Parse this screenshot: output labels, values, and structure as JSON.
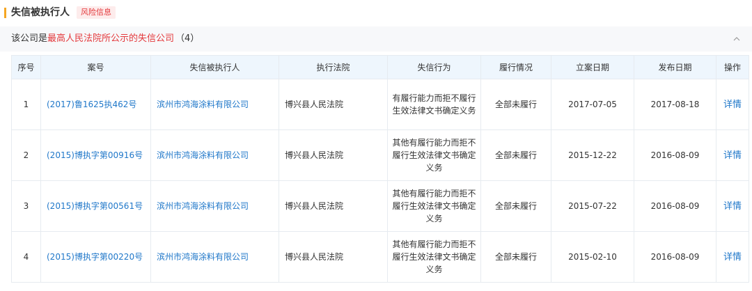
{
  "header": {
    "title": "失信被执行人",
    "tag": "风险信息"
  },
  "summary": {
    "prefix": "该公司是",
    "highlight": "最高人民法院所公示的失信公司",
    "count": "（4）"
  },
  "table": {
    "columns": [
      "序号",
      "案号",
      "失信被执行人",
      "执行法院",
      "失信行为",
      "履行情况",
      "立案日期",
      "发布日期",
      "操作"
    ],
    "rows": [
      {
        "index": "1",
        "case_no": "(2017)鲁1625执462号",
        "executee": "滨州市鸿海涂料有限公司",
        "court": "博兴县人民法院",
        "behavior": "有履行能力而拒不履行生效法律文书确定义务",
        "status": "全部未履行",
        "filing_date": "2017-07-05",
        "publish_date": "2017-08-18",
        "action": "详情"
      },
      {
        "index": "2",
        "case_no": "(2015)博执字第00916号",
        "executee": "滨州市鸿海涂料有限公司",
        "court": "博兴县人民法院",
        "behavior": "其他有履行能力而拒不履行生效法律文书确定义务",
        "status": "全部未履行",
        "filing_date": "2015-12-22",
        "publish_date": "2016-08-09",
        "action": "详情"
      },
      {
        "index": "3",
        "case_no": "(2015)博执字第00561号",
        "executee": "滨州市鸿海涂料有限公司",
        "court": "博兴县人民法院",
        "behavior": "其他有履行能力而拒不履行生效法律文书确定义务",
        "status": "全部未履行",
        "filing_date": "2015-07-22",
        "publish_date": "2016-08-09",
        "action": "详情"
      },
      {
        "index": "4",
        "case_no": "(2015)博执字第00220号",
        "executee": "滨州市鸿海涂料有限公司",
        "court": "博兴县人民法院",
        "behavior": "其他有履行能力而拒不履行生效法律文书确定义务",
        "status": "全部未履行",
        "filing_date": "2015-02-10",
        "publish_date": "2016-08-09",
        "action": "详情"
      }
    ]
  },
  "icons": {
    "collapse": "chevron-up-icon"
  }
}
